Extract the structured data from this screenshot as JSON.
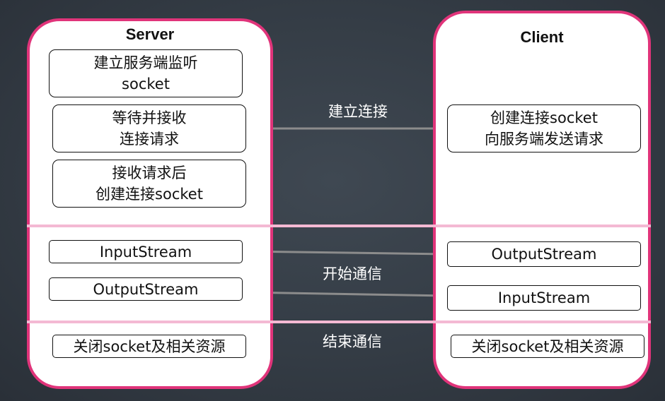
{
  "server": {
    "title": "Server",
    "steps": [
      [
        "建立服务端监听",
        "socket"
      ],
      [
        "等待并接收",
        "连接请求"
      ],
      [
        "接收请求后",
        "创建连接socket"
      ]
    ],
    "input_stream": "InputStream",
    "output_stream": "OutputStream",
    "close": "关闭socket及相关资源"
  },
  "client": {
    "title": "Client",
    "step": [
      "创建连接socket",
      "向服务端发送请求"
    ],
    "output_stream": "OutputStream",
    "input_stream": "InputStream",
    "close": "关闭socket及相关资源"
  },
  "labels": {
    "connect": "建立连接",
    "communicate": "开始通信",
    "end": "结束通信"
  },
  "colors": {
    "panel_border": "#e0347a",
    "divider": "#f4b9d3",
    "connector": "#8c8c8c",
    "background": "#343c45"
  }
}
